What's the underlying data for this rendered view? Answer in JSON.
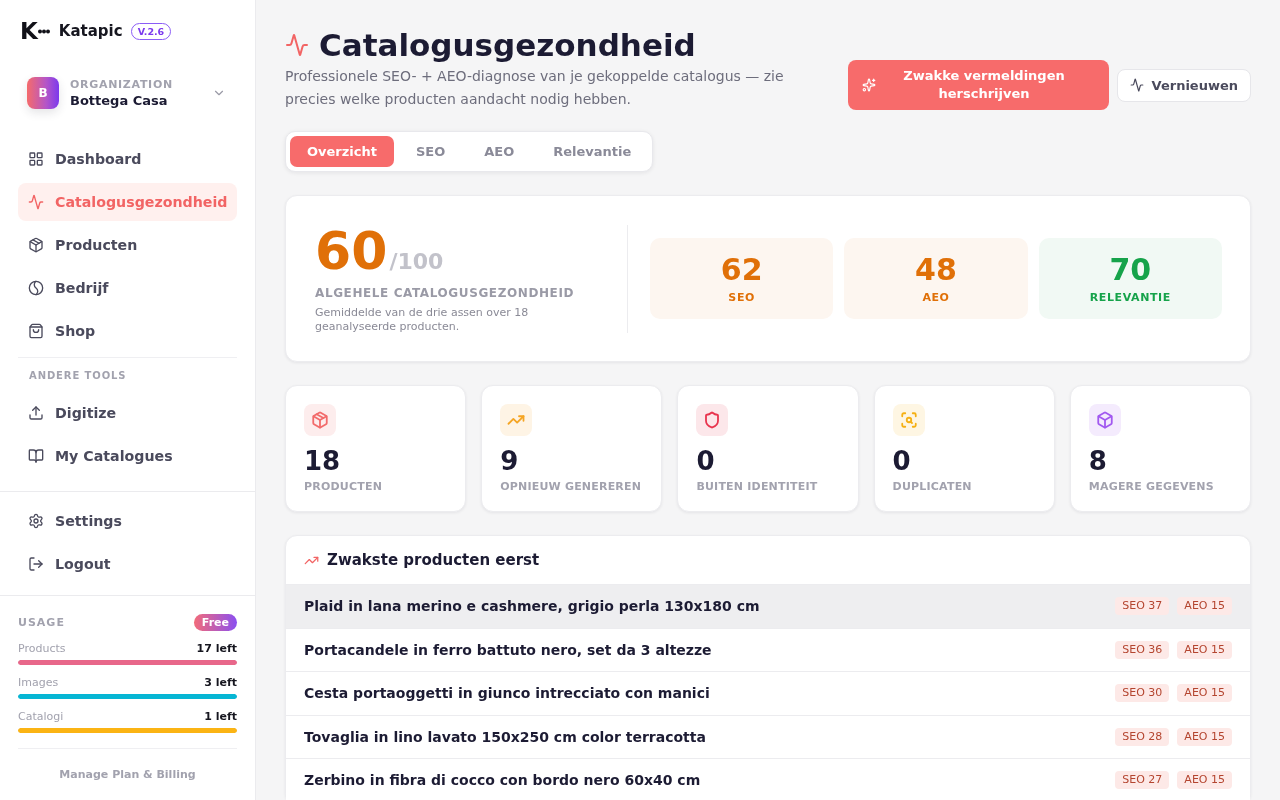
{
  "sidebar": {
    "logo": {
      "mark": "K",
      "name": "Katapic",
      "version": "V.2.6"
    },
    "organization": {
      "label": "ORGANIZATION",
      "initial": "B",
      "name": "Bottega Casa"
    },
    "nav": [
      {
        "label": "Dashboard",
        "selected": false
      },
      {
        "label": "Catalogusgezondheid",
        "selected": true
      },
      {
        "label": "Producten",
        "selected": false
      },
      {
        "label": "Bedrijf",
        "selected": false
      },
      {
        "label": "Shop",
        "selected": false
      }
    ],
    "tools_title": "ANDERE TOOLS",
    "tools": [
      {
        "label": "Digitize",
        "selected": false
      },
      {
        "label": "My Catalogues",
        "selected": false
      }
    ],
    "account": [
      {
        "label": "Settings",
        "selected": false
      },
      {
        "label": "Logout",
        "selected": false
      }
    ],
    "usage": {
      "title": "USAGE",
      "plan": "Free",
      "items": [
        {
          "label": "Products",
          "reading": "17 left",
          "level": 1,
          "color": "#e8678a"
        },
        {
          "label": "Images",
          "reading": "3 left",
          "level": 1,
          "color": "#06b6d4"
        },
        {
          "label": "Catalogi",
          "reading": "1 left",
          "level": 1,
          "color": "#fbb414"
        }
      ]
    },
    "billing_link": "Manage Plan & Billing"
  },
  "header": {
    "title": "Catalogusgezondheid",
    "subtitle": "Professionele SEO- + AEO-diagnose van je gekoppelde catalogus — zie precies welke producten aandacht nodig hebben.",
    "primary_button": "Zwakke vermeldingen herschrijven",
    "secondary_button": "Vernieuwen"
  },
  "tabs": [
    {
      "label": "Overzicht",
      "selected": true
    },
    {
      "label": "SEO",
      "selected": false
    },
    {
      "label": "AEO",
      "selected": false
    },
    {
      "label": "Relevantie",
      "selected": false
    }
  ],
  "overall": {
    "score": "60",
    "max": "/100",
    "label": "ALGEHELE CATALOGUSGEZONDHEID",
    "description": "Gemiddelde van de drie assen over 18 geanalyseerde producten.",
    "axes": [
      {
        "value": "62",
        "label": "SEO",
        "color": "#e07008"
      },
      {
        "value": "48",
        "label": "AEO",
        "color": "#e07008"
      },
      {
        "value": "70",
        "label": "RELEVANTIE",
        "color": "#16a34a"
      }
    ]
  },
  "stats": [
    {
      "value": "18",
      "label": "PRODUCTEN",
      "color": "#f26b6b"
    },
    {
      "value": "9",
      "label": "OPNIEUW GENEREREN",
      "color": "#f5a524"
    },
    {
      "value": "0",
      "label": "BUITEN IDENTITEIT",
      "color": "#e8344e"
    },
    {
      "value": "0",
      "label": "DUPLICATEN",
      "color": "#f5b014"
    },
    {
      "value": "8",
      "label": "MAGERE GEGEVENS",
      "color": "#a259f0"
    }
  ],
  "weakest": {
    "title": "Zwakste producten eerst",
    "rows": [
      {
        "name": "Plaid in lana merino e cashmere, grigio perla 130x180 cm",
        "badges": [
          "SEO 37",
          "AEO 15"
        ],
        "highlighted": true
      },
      {
        "name": "Portacandele in ferro battuto nero, set da 3 altezze",
        "badges": [
          "SEO 36",
          "AEO 15"
        ],
        "highlighted": false
      },
      {
        "name": "Cesta portaoggetti in giunco intrecciato con manici",
        "badges": [
          "SEO 30",
          "AEO 15"
        ],
        "highlighted": false
      },
      {
        "name": "Tovaglia in lino lavato 150x250 cm color terracotta",
        "badges": [
          "SEO 28",
          "AEO 15"
        ],
        "highlighted": false
      },
      {
        "name": "Zerbino in fibra di cocco con bordo nero 60x40 cm",
        "badges": [
          "SEO 27",
          "AEO 15"
        ],
        "highlighted": false
      }
    ]
  }
}
